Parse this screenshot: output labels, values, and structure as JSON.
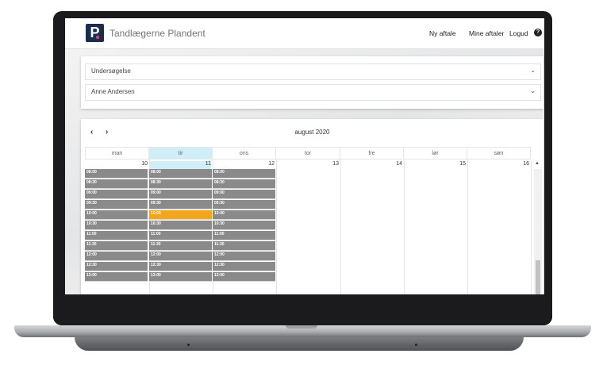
{
  "app": {
    "brand": "Tandlægerne Plandent",
    "logo_letter": "P"
  },
  "nav": {
    "new_appointment": "Ny aftale",
    "my_appointments": "Mine aftaler",
    "logout": "Logud",
    "help_icon": "?"
  },
  "filters": {
    "service": "Undersøgelse",
    "dentist": "Anne Andersen"
  },
  "calendar": {
    "month_label": "august 2020",
    "prev": "‹",
    "next": "›",
    "days": [
      {
        "name": "man",
        "date": "10",
        "today": false,
        "open": true
      },
      {
        "name": "tir",
        "date": "11",
        "today": true,
        "open": true
      },
      {
        "name": "ons",
        "date": "12",
        "today": false,
        "open": true
      },
      {
        "name": "tor",
        "date": "13",
        "today": false,
        "open": false
      },
      {
        "name": "fre",
        "date": "14",
        "today": false,
        "open": false
      },
      {
        "name": "lør",
        "date": "15",
        "today": false,
        "open": false
      },
      {
        "name": "søn",
        "date": "16",
        "today": false,
        "open": false
      }
    ],
    "times": [
      "08:00",
      "08:30",
      "09:00",
      "09:30",
      "10:00",
      "10:30",
      "11:00",
      "11:30",
      "12:00",
      "12:30",
      "13:00"
    ],
    "selected": {
      "day": "tir",
      "time": "10:00"
    },
    "colors": {
      "available": "#8a8a8a",
      "selected": "#f3a51c",
      "today": "#cfeef8"
    }
  }
}
